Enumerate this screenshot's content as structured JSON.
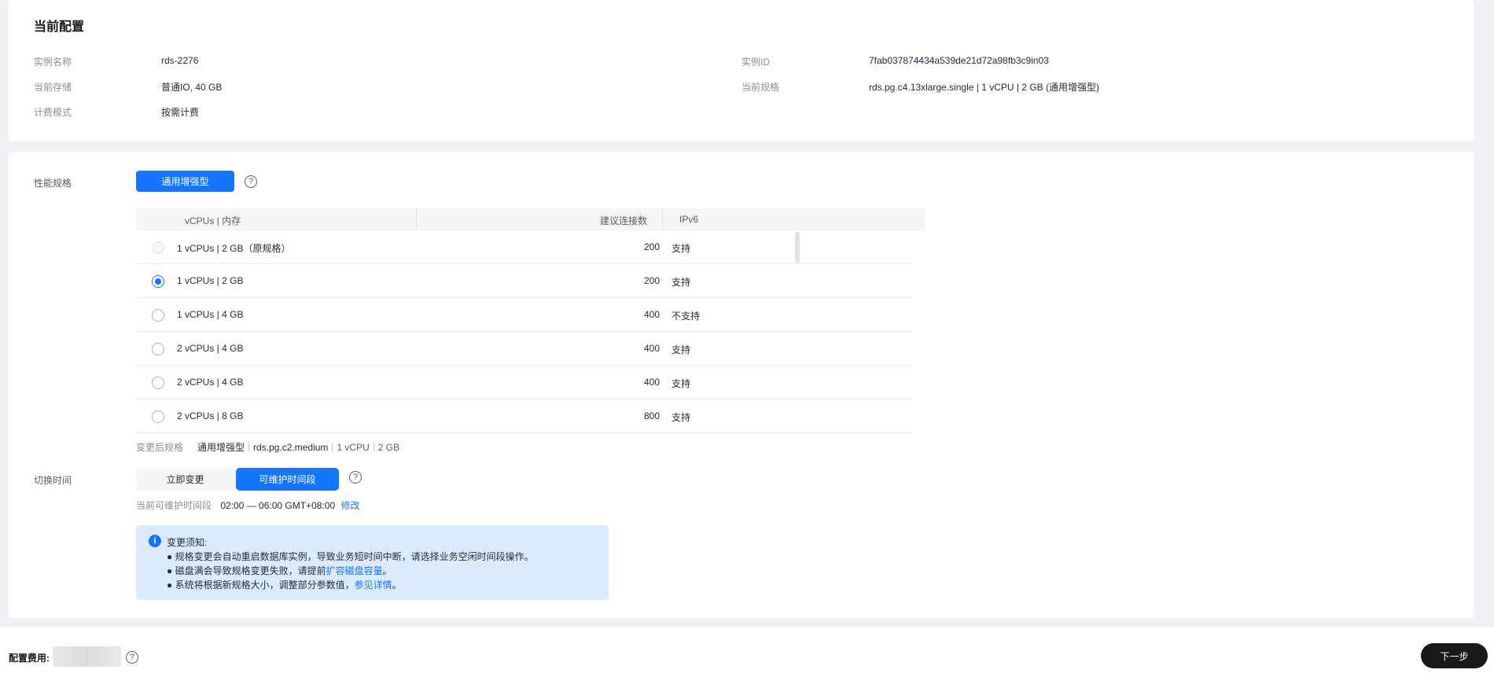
{
  "current_config": {
    "title": "当前配置",
    "instance_name_label": "实例名称",
    "instance_name": "rds-2276",
    "instance_id_label": "实例ID",
    "instance_id": "7fab037874434a539de21d72a98fb3c9in03",
    "storage_label": "当前存储",
    "storage": "普通IO, 40 GB",
    "spec_label": "当前规格",
    "spec": "rds.pg.c4.13xlarge.single | 1 vCPU | 2 GB (通用增强型)",
    "billing_label": "计费模式",
    "billing": "按需计费"
  },
  "performance": {
    "label": "性能规格",
    "type_button": "通用增强型",
    "help": "?",
    "columns": [
      "vCPUs | 内存",
      "建议连接数",
      "IPv6"
    ],
    "rows": [
      {
        "spec": "1 vCPUs | 2 GB（原规格）",
        "connections": "200",
        "ipv6": "支持",
        "state": "disabled"
      },
      {
        "spec": "1 vCPUs | 2 GB",
        "connections": "200",
        "ipv6": "支持",
        "state": "checked"
      },
      {
        "spec": "1 vCPUs | 4 GB",
        "connections": "400",
        "ipv6": "不支持",
        "state": "unchecked"
      },
      {
        "spec": "2 vCPUs | 4 GB",
        "connections": "400",
        "ipv6": "支持",
        "state": "unchecked"
      },
      {
        "spec": "2 vCPUs | 4 GB",
        "connections": "400",
        "ipv6": "支持",
        "state": "unchecked"
      },
      {
        "spec": "2 vCPUs | 8 GB",
        "connections": "800",
        "ipv6": "支持",
        "state": "unchecked"
      }
    ],
    "after_spec_label": "变更后规格",
    "after_spec": [
      "通用增强型",
      "rds.pg.c2.medium",
      "1 vCPU",
      "2 GB"
    ]
  },
  "switch_time": {
    "label": "切换时间",
    "options": [
      "立即变更",
      "可维护时间段"
    ],
    "selected": "可维护时间段",
    "help": "?",
    "maintenance_label": "当前可维护时间段",
    "maintenance_value": "02:00 — 06:00 GMT+08:00",
    "modify_link": "修改"
  },
  "notice": {
    "icon": "i",
    "title": "变更须知:",
    "item1": "● 规格变更会自动重启数据库实例，导致业务短时间中断，请选择业务空闲时间段操作。",
    "item2_prefix": "● 磁盘满会导致规格变更失败，请提前",
    "item2_link": "扩容磁盘容量",
    "item2_suffix": "。",
    "item3_prefix": "● 系统将根据新规格大小，调整部分参数值，",
    "item3_link": "参见详情",
    "item3_suffix": "。"
  },
  "footer": {
    "fee_label": "配置费用:",
    "help": "?",
    "next_button": "下一步"
  },
  "colors": {
    "primary": "#1476ff",
    "notice_bg": "#dbeaff",
    "dark_button": "#191919"
  }
}
